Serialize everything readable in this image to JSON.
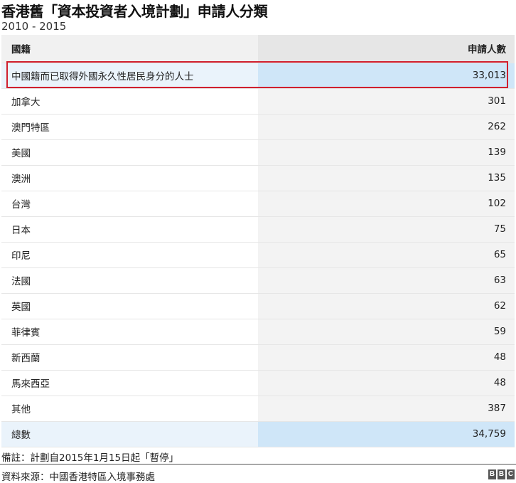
{
  "chart_data": {
    "type": "table",
    "title": "香港舊「資本投資者入境計劃」申請人分類",
    "subtitle": "2010 - 2015",
    "columns": [
      "國籍",
      "申請人數"
    ],
    "rows": [
      {
        "country": "中國籍而已取得外國永久性居民身分的人士",
        "count": "33,013",
        "highlighted": true
      },
      {
        "country": "加拿大",
        "count": "301"
      },
      {
        "country": "澳門特區",
        "count": "262"
      },
      {
        "country": "美國",
        "count": "139"
      },
      {
        "country": "澳洲",
        "count": "135"
      },
      {
        "country": "台灣",
        "count": "102"
      },
      {
        "country": "日本",
        "count": "75"
      },
      {
        "country": "印尼",
        "count": "65"
      },
      {
        "country": "法國",
        "count": "63"
      },
      {
        "country": "英國",
        "count": "62"
      },
      {
        "country": "菲律賓",
        "count": "59"
      },
      {
        "country": "新西蘭",
        "count": "48"
      },
      {
        "country": "馬來西亞",
        "count": "48"
      },
      {
        "country": "其他",
        "count": "387"
      }
    ],
    "total": {
      "label": "總數",
      "count": "34,759"
    },
    "note": "備註：計劃自2015年1月15日起「暫停」",
    "source": "資料來源：中國香港特區入境事務處"
  },
  "logo": {
    "letters": [
      "B",
      "B",
      "C"
    ]
  },
  "colors": {
    "highlight_border": "#d0202e",
    "total_row_bg": "#cfe6f8",
    "header_bg": "#f1f1f1"
  }
}
